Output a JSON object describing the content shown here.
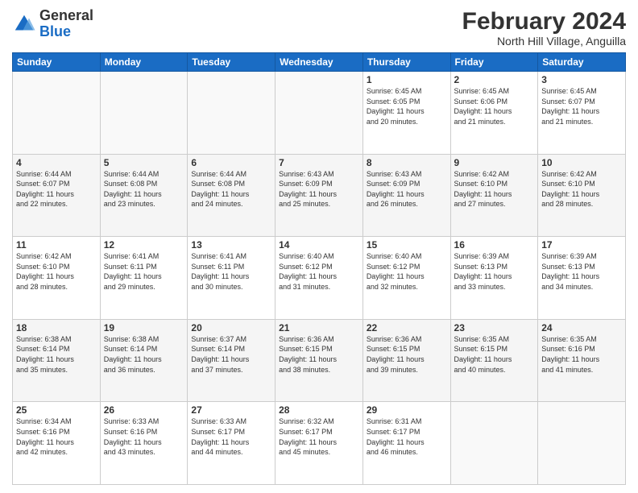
{
  "header": {
    "logo_general": "General",
    "logo_blue": "Blue",
    "month_year": "February 2024",
    "location": "North Hill Village, Anguilla"
  },
  "weekdays": [
    "Sunday",
    "Monday",
    "Tuesday",
    "Wednesday",
    "Thursday",
    "Friday",
    "Saturday"
  ],
  "rows": [
    [
      {
        "day": "",
        "info": ""
      },
      {
        "day": "",
        "info": ""
      },
      {
        "day": "",
        "info": ""
      },
      {
        "day": "",
        "info": ""
      },
      {
        "day": "1",
        "info": "Sunrise: 6:45 AM\nSunset: 6:05 PM\nDaylight: 11 hours\nand 20 minutes."
      },
      {
        "day": "2",
        "info": "Sunrise: 6:45 AM\nSunset: 6:06 PM\nDaylight: 11 hours\nand 21 minutes."
      },
      {
        "day": "3",
        "info": "Sunrise: 6:45 AM\nSunset: 6:07 PM\nDaylight: 11 hours\nand 21 minutes."
      }
    ],
    [
      {
        "day": "4",
        "info": "Sunrise: 6:44 AM\nSunset: 6:07 PM\nDaylight: 11 hours\nand 22 minutes."
      },
      {
        "day": "5",
        "info": "Sunrise: 6:44 AM\nSunset: 6:08 PM\nDaylight: 11 hours\nand 23 minutes."
      },
      {
        "day": "6",
        "info": "Sunrise: 6:44 AM\nSunset: 6:08 PM\nDaylight: 11 hours\nand 24 minutes."
      },
      {
        "day": "7",
        "info": "Sunrise: 6:43 AM\nSunset: 6:09 PM\nDaylight: 11 hours\nand 25 minutes."
      },
      {
        "day": "8",
        "info": "Sunrise: 6:43 AM\nSunset: 6:09 PM\nDaylight: 11 hours\nand 26 minutes."
      },
      {
        "day": "9",
        "info": "Sunrise: 6:42 AM\nSunset: 6:10 PM\nDaylight: 11 hours\nand 27 minutes."
      },
      {
        "day": "10",
        "info": "Sunrise: 6:42 AM\nSunset: 6:10 PM\nDaylight: 11 hours\nand 28 minutes."
      }
    ],
    [
      {
        "day": "11",
        "info": "Sunrise: 6:42 AM\nSunset: 6:10 PM\nDaylight: 11 hours\nand 28 minutes."
      },
      {
        "day": "12",
        "info": "Sunrise: 6:41 AM\nSunset: 6:11 PM\nDaylight: 11 hours\nand 29 minutes."
      },
      {
        "day": "13",
        "info": "Sunrise: 6:41 AM\nSunset: 6:11 PM\nDaylight: 11 hours\nand 30 minutes."
      },
      {
        "day": "14",
        "info": "Sunrise: 6:40 AM\nSunset: 6:12 PM\nDaylight: 11 hours\nand 31 minutes."
      },
      {
        "day": "15",
        "info": "Sunrise: 6:40 AM\nSunset: 6:12 PM\nDaylight: 11 hours\nand 32 minutes."
      },
      {
        "day": "16",
        "info": "Sunrise: 6:39 AM\nSunset: 6:13 PM\nDaylight: 11 hours\nand 33 minutes."
      },
      {
        "day": "17",
        "info": "Sunrise: 6:39 AM\nSunset: 6:13 PM\nDaylight: 11 hours\nand 34 minutes."
      }
    ],
    [
      {
        "day": "18",
        "info": "Sunrise: 6:38 AM\nSunset: 6:14 PM\nDaylight: 11 hours\nand 35 minutes."
      },
      {
        "day": "19",
        "info": "Sunrise: 6:38 AM\nSunset: 6:14 PM\nDaylight: 11 hours\nand 36 minutes."
      },
      {
        "day": "20",
        "info": "Sunrise: 6:37 AM\nSunset: 6:14 PM\nDaylight: 11 hours\nand 37 minutes."
      },
      {
        "day": "21",
        "info": "Sunrise: 6:36 AM\nSunset: 6:15 PM\nDaylight: 11 hours\nand 38 minutes."
      },
      {
        "day": "22",
        "info": "Sunrise: 6:36 AM\nSunset: 6:15 PM\nDaylight: 11 hours\nand 39 minutes."
      },
      {
        "day": "23",
        "info": "Sunrise: 6:35 AM\nSunset: 6:15 PM\nDaylight: 11 hours\nand 40 minutes."
      },
      {
        "day": "24",
        "info": "Sunrise: 6:35 AM\nSunset: 6:16 PM\nDaylight: 11 hours\nand 41 minutes."
      }
    ],
    [
      {
        "day": "25",
        "info": "Sunrise: 6:34 AM\nSunset: 6:16 PM\nDaylight: 11 hours\nand 42 minutes."
      },
      {
        "day": "26",
        "info": "Sunrise: 6:33 AM\nSunset: 6:16 PM\nDaylight: 11 hours\nand 43 minutes."
      },
      {
        "day": "27",
        "info": "Sunrise: 6:33 AM\nSunset: 6:17 PM\nDaylight: 11 hours\nand 44 minutes."
      },
      {
        "day": "28",
        "info": "Sunrise: 6:32 AM\nSunset: 6:17 PM\nDaylight: 11 hours\nand 45 minutes."
      },
      {
        "day": "29",
        "info": "Sunrise: 6:31 AM\nSunset: 6:17 PM\nDaylight: 11 hours\nand 46 minutes."
      },
      {
        "day": "",
        "info": ""
      },
      {
        "day": "",
        "info": ""
      }
    ]
  ]
}
